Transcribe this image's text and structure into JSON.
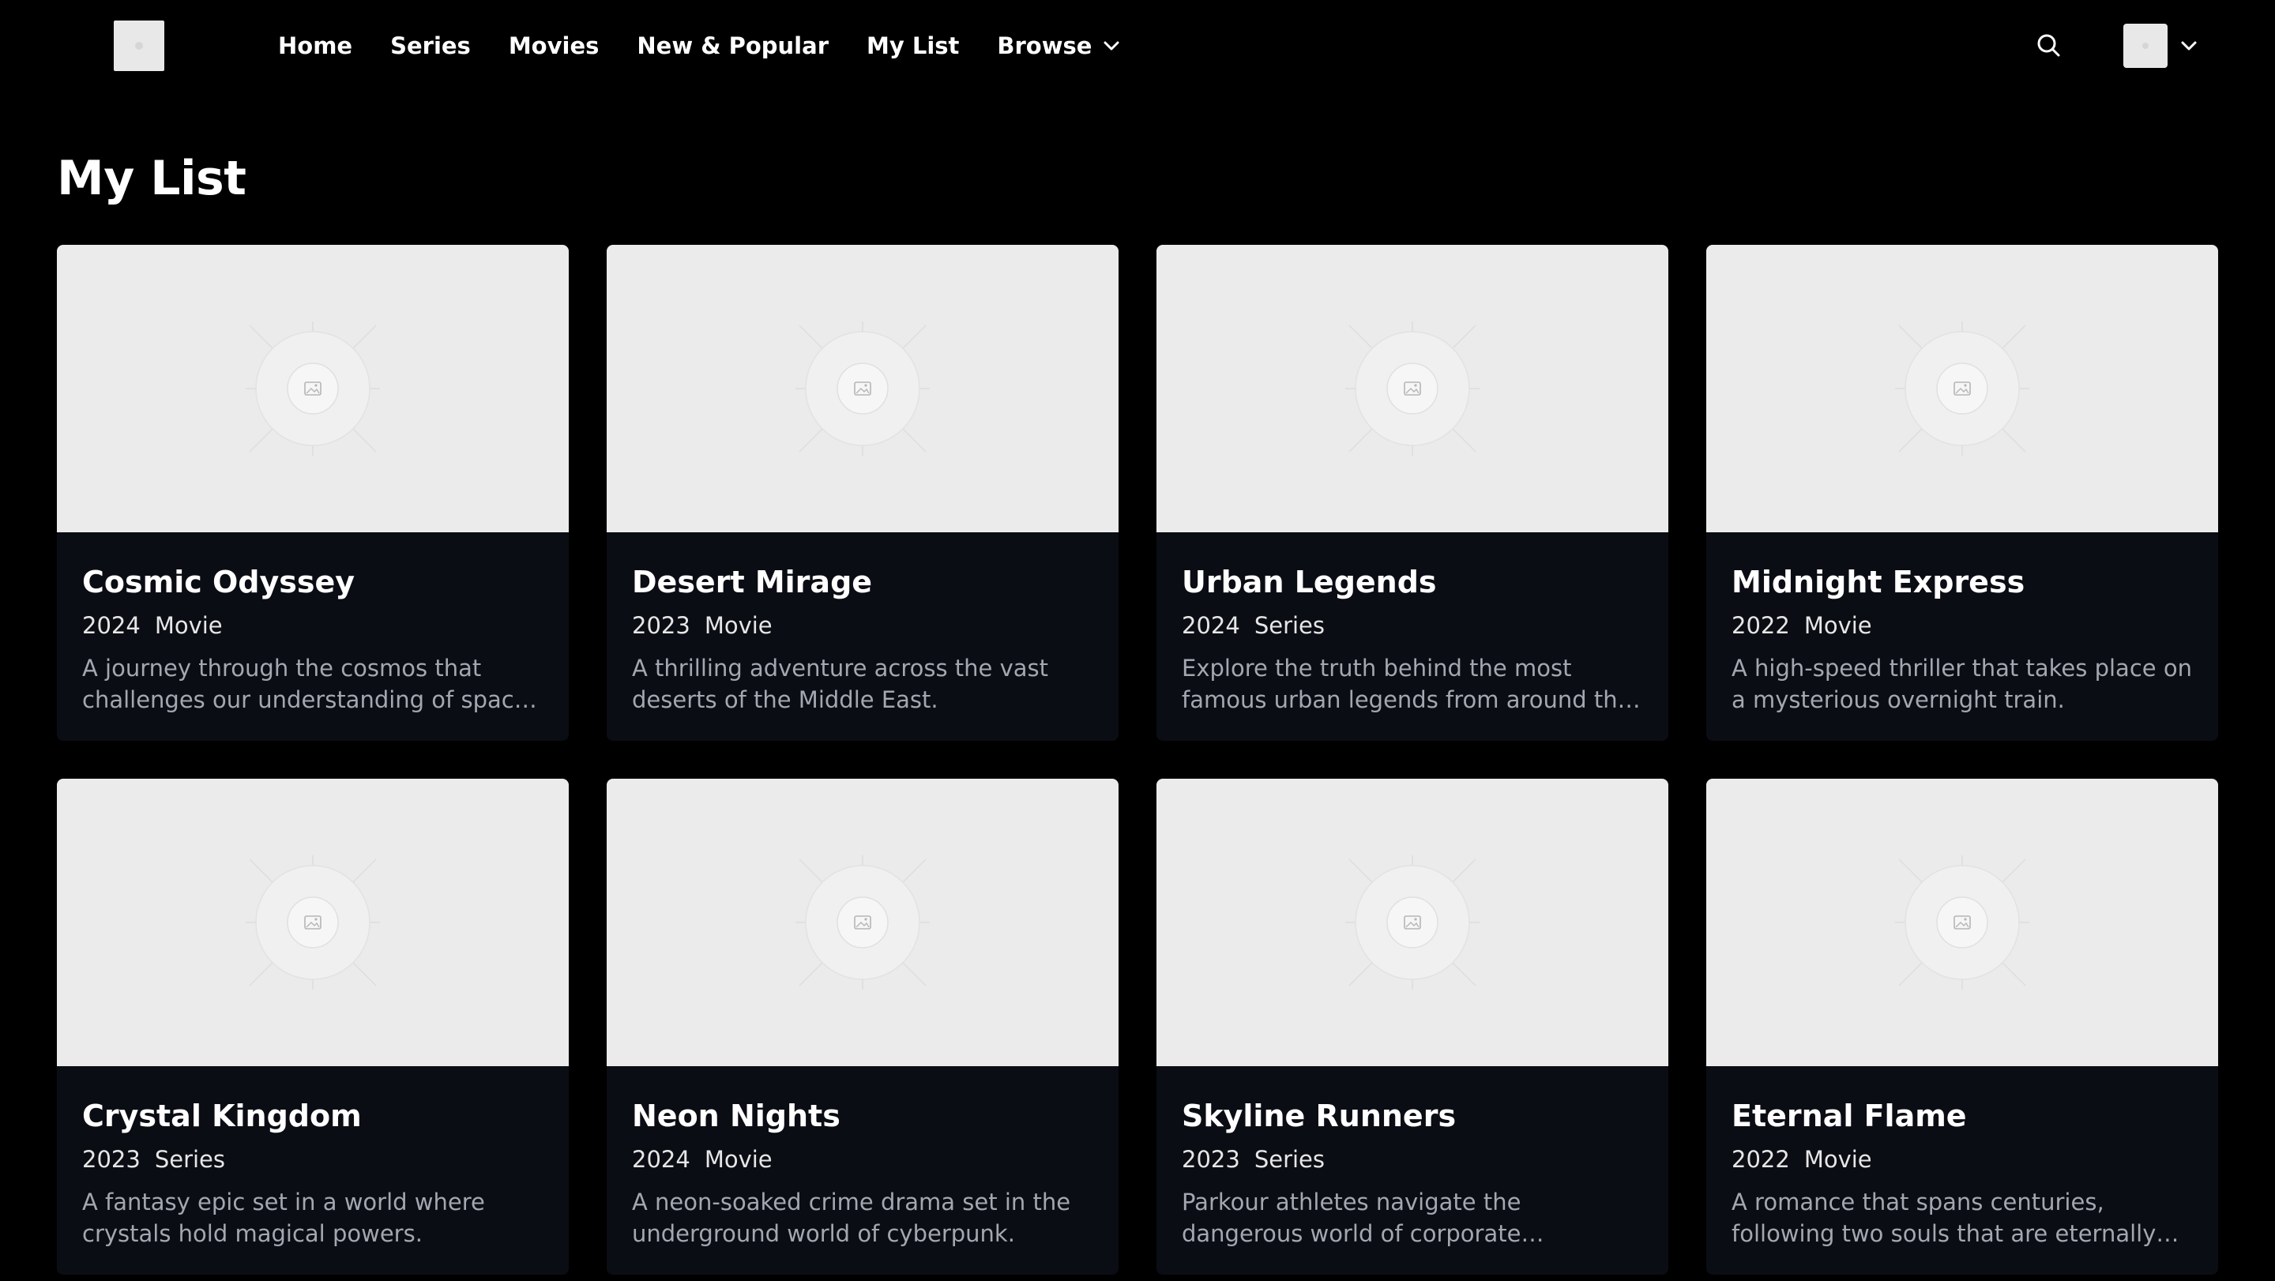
{
  "nav": {
    "links": [
      {
        "label": "Home"
      },
      {
        "label": "Series"
      },
      {
        "label": "Movies"
      },
      {
        "label": "New & Popular"
      },
      {
        "label": "My List"
      }
    ],
    "browse_label": "Browse"
  },
  "page": {
    "title": "My List"
  },
  "items": [
    {
      "title": "Cosmic Odyssey",
      "year": "2024",
      "type": "Movie",
      "description": "A journey through the cosmos that challenges our understanding of space and time."
    },
    {
      "title": "Desert Mirage",
      "year": "2023",
      "type": "Movie",
      "description": "A thrilling adventure across the vast deserts of the Middle East."
    },
    {
      "title": "Urban Legends",
      "year": "2024",
      "type": "Series",
      "description": "Explore the truth behind the most famous urban legends from around the world."
    },
    {
      "title": "Midnight Express",
      "year": "2022",
      "type": "Movie",
      "description": "A high-speed thriller that takes place on a mysterious overnight train."
    },
    {
      "title": "Crystal Kingdom",
      "year": "2023",
      "type": "Series",
      "description": "A fantasy epic set in a world where crystals hold magical powers."
    },
    {
      "title": "Neon Nights",
      "year": "2024",
      "type": "Movie",
      "description": "A neon-soaked crime drama set in the underground world of cyberpunk."
    },
    {
      "title": "Skyline Runners",
      "year": "2023",
      "type": "Series",
      "description": "Parkour athletes navigate the dangerous world of corporate espionage."
    },
    {
      "title": "Eternal Flame",
      "year": "2022",
      "type": "Movie",
      "description": "A romance that spans centuries, following two souls that are eternally connected."
    }
  ],
  "colors": {
    "background": "#000000",
    "card_background": "#0b0d14",
    "placeholder": "#ebebeb",
    "description_text": "#a3a7b0"
  }
}
